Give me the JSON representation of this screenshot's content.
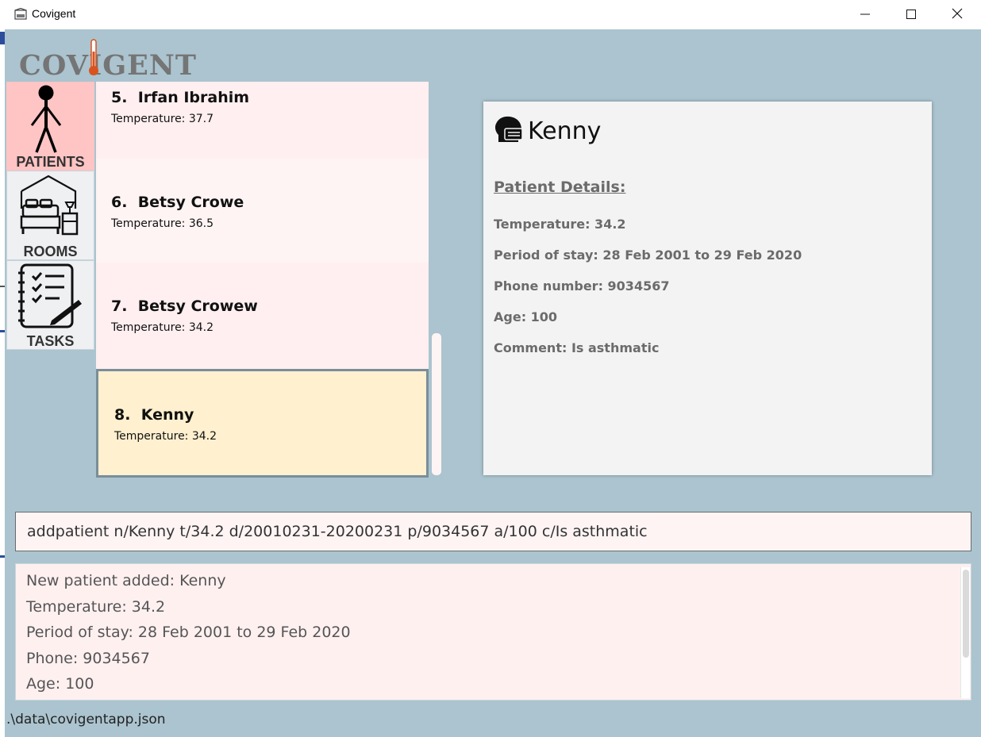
{
  "window": {
    "title": "Covigent",
    "minimize_icon": "minimize-icon",
    "maximize_icon": "maximize-icon",
    "close_icon": "close-icon"
  },
  "logo": {
    "text": "COVIGENT"
  },
  "nav": [
    {
      "label": "PATIENTS",
      "icon": "stick-figure-icon",
      "active": true,
      "active_color": "#ffc4c4"
    },
    {
      "label": "ROOMS",
      "icon": "bedroom-icon",
      "active": false
    },
    {
      "label": "TASKS",
      "icon": "checklist-icon",
      "active": false
    }
  ],
  "patients": [
    {
      "index": "5.",
      "name": "Irfan Ibrahim",
      "temperature": "Temperature: 37.7"
    },
    {
      "index": "6.",
      "name": "Betsy Crowe",
      "temperature": "Temperature: 36.5"
    },
    {
      "index": "7.",
      "name": "Betsy Crowew",
      "temperature": "Temperature: 34.2"
    },
    {
      "index": "8.",
      "name": "Kenny",
      "temperature": "Temperature: 34.2",
      "selected": true
    }
  ],
  "detail": {
    "icon": "patient-head-icon",
    "name": "Kenny",
    "heading": "Patient Details:",
    "lines": [
      "Temperature: 34.2",
      "Period of stay: 28 Feb 2001 to 29 Feb 2020",
      "Phone number: 9034567",
      "Age: 100",
      "Comment: Is asthmatic"
    ]
  },
  "command": {
    "value": "addpatient n/Kenny t/34.2 d/20010231-20200231 p/9034567 a/100 c/Is asthmatic"
  },
  "result": {
    "lines": [
      "New patient added: Kenny",
      "Temperature: 34.2",
      "Period of stay: 28 Feb 2001 to 29 Feb 2020",
      "Phone: 9034567",
      "Age: 100"
    ]
  },
  "status": {
    "path": ".\\data\\covigentapp.json"
  },
  "colors": {
    "background": "#abc4cf",
    "card": "#ffeff0",
    "selected_card": "#fff0cf",
    "active_nav": "#ffc4c4",
    "logo_mercury": "#d9531e"
  }
}
